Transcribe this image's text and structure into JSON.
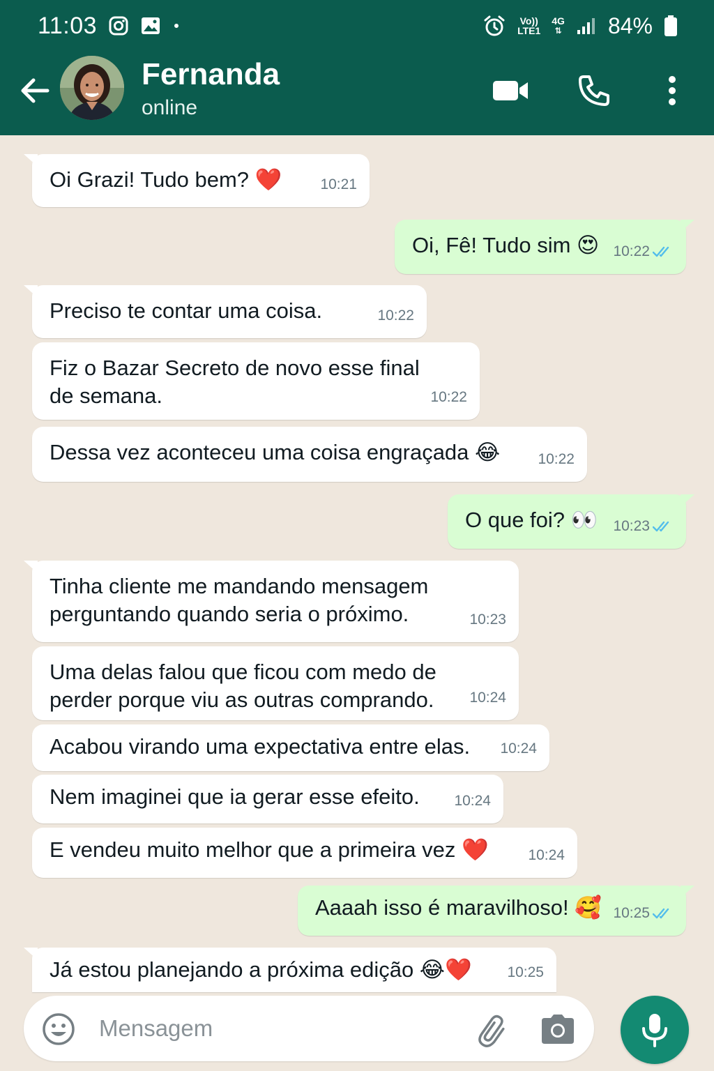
{
  "status_bar": {
    "time": "11:03",
    "volte_top": "Vo))",
    "volte_bottom": "LTE1",
    "network": "4G",
    "battery": "84%"
  },
  "header": {
    "contact_name": "Fernanda",
    "contact_status": "online"
  },
  "messages": [
    {
      "direction": "in",
      "text": "Oi Grazi! Tudo bem? ❤️",
      "time": "10:21"
    },
    {
      "direction": "out",
      "text": "Oi, Fê! Tudo sim 😍",
      "time": "10:22",
      "read": true
    },
    {
      "direction": "in",
      "text": "Preciso te contar uma coisa.",
      "time": "10:22"
    },
    {
      "direction": "in",
      "text": "Fiz o Bazar Secreto de novo esse final de semana.",
      "time": "10:22"
    },
    {
      "direction": "in",
      "text": "Dessa vez aconteceu uma coisa engraçada 😂",
      "time": "10:22"
    },
    {
      "direction": "out",
      "text": "O que foi? 👀",
      "time": "10:23",
      "read": true
    },
    {
      "direction": "in",
      "text": "Tinha cliente me mandando mensagem perguntando quando seria o próximo.",
      "time": "10:23"
    },
    {
      "direction": "in",
      "text": "Uma delas falou que ficou com medo de perder porque viu as outras comprando.",
      "time": "10:24"
    },
    {
      "direction": "in",
      "text": "Acabou virando uma expectativa entre elas.",
      "time": "10:24"
    },
    {
      "direction": "in",
      "text": "Nem imaginei que ia gerar esse efeito.",
      "time": "10:24"
    },
    {
      "direction": "in",
      "text": "E vendeu muito melhor que a primeira vez ❤️",
      "time": "10:24"
    },
    {
      "direction": "out",
      "text": "Aaaah isso é maravilhoso! 🥰",
      "time": "10:25",
      "read": true
    },
    {
      "direction": "in",
      "text": "Já estou planejando a próxima edição 😂❤️",
      "time": "10:25"
    }
  ],
  "composer": {
    "placeholder": "Mensagem"
  },
  "icons": {
    "back": "arrow-left-icon",
    "video": "video-camera-icon",
    "call": "phone-icon",
    "more": "more-vertical-icon",
    "emoji": "emoji-icon",
    "attach": "paperclip-icon",
    "camera": "camera-icon",
    "mic": "microphone-icon",
    "read_receipt": "double-check-icon"
  },
  "colors": {
    "header": "#0b5c4e",
    "incoming_bubble": "#ffffff",
    "outgoing_bubble": "#d9fdd3",
    "chat_background": "#efe7dd",
    "read_check": "#53bdeb",
    "mic_button": "#138a72"
  }
}
